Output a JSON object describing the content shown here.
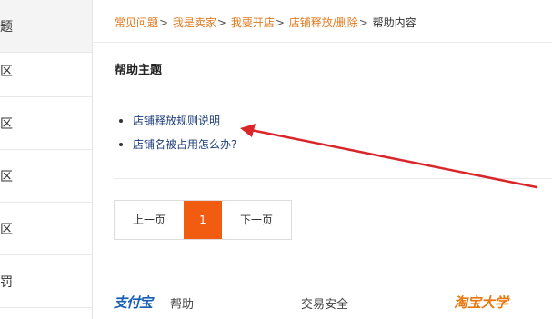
{
  "sidebar": {
    "items": [
      {
        "label": "题"
      },
      {
        "label": "区"
      },
      {
        "label": "区"
      },
      {
        "label": "区"
      },
      {
        "label": "区"
      },
      {
        "label": "罚"
      }
    ]
  },
  "breadcrumb": {
    "items": [
      "常见问题",
      "我是卖家",
      "我要开店",
      "店铺释放/删除"
    ],
    "separator": ">",
    "current": "帮助内容"
  },
  "main": {
    "topic_title": "帮助主题",
    "topics": [
      "店铺释放规则说明",
      "店铺名被占用怎么办?"
    ]
  },
  "pager": {
    "prev_label": "上一页",
    "current_page": "1",
    "next_label": "下一页"
  },
  "footer": {
    "alipay_logo": "支付宝",
    "help_label": "帮助",
    "trade_safety": "交易安全",
    "taobao_university": "淘宝大学"
  },
  "colors": {
    "accent": "#f25c11",
    "breadcrumb_link": "#e07a1f",
    "topic_link": "#1d3e7a",
    "annotation_arrow": "#d9262b"
  }
}
